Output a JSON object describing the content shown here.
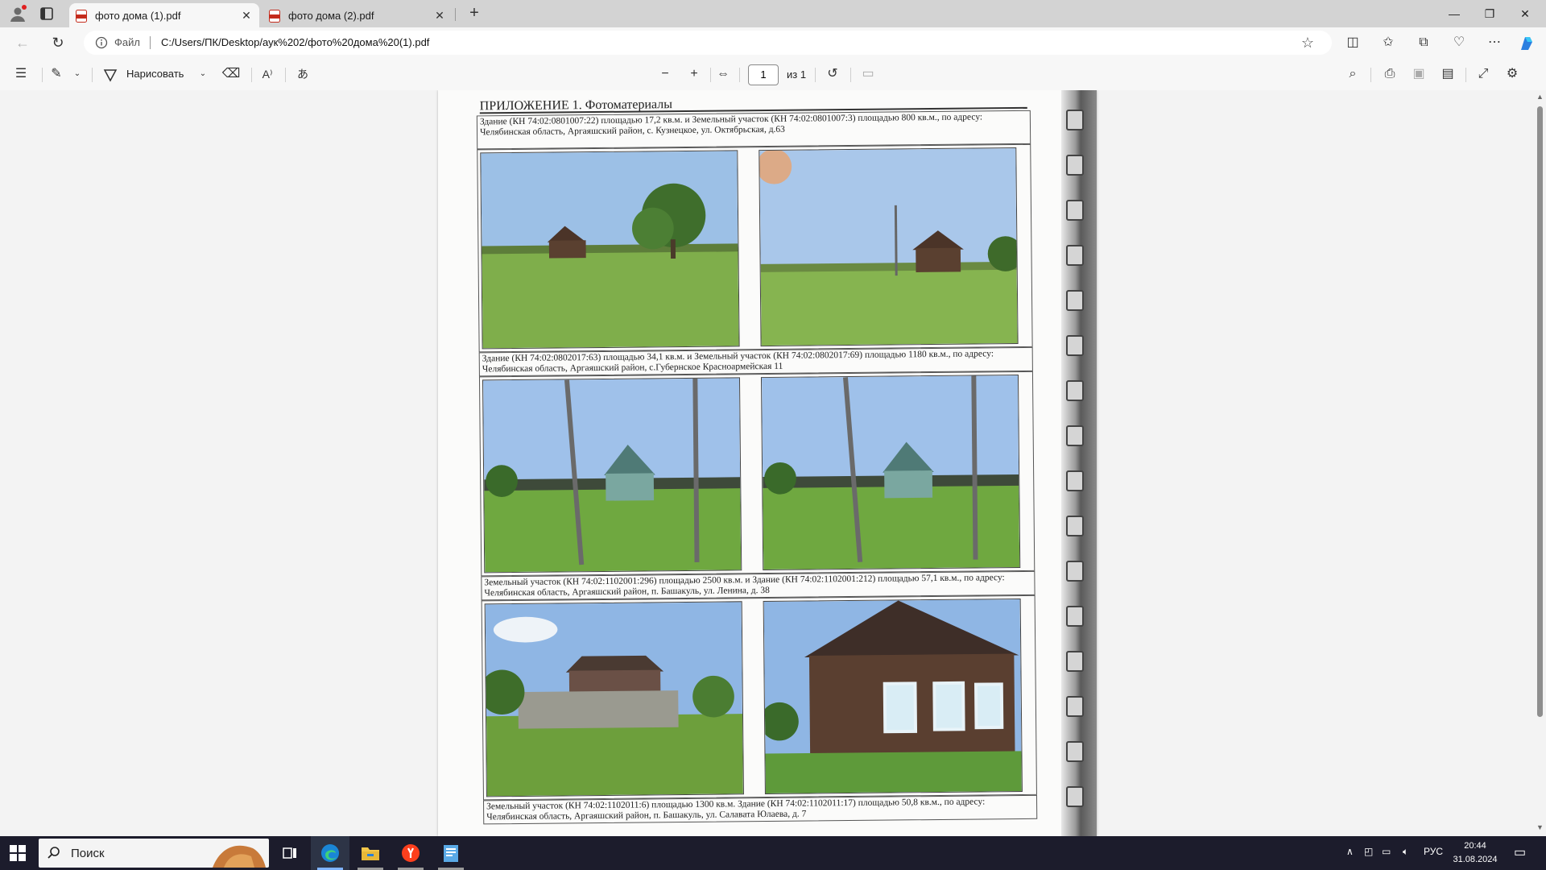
{
  "browser": {
    "tabs": [
      {
        "label": "фото дома (1).pdf",
        "active": true
      },
      {
        "label": "фото дома (2).pdf",
        "active": false
      }
    ],
    "address": {
      "scheme": "Файл",
      "url": "C:/Users/ПК/Desktop/аук%202/фото%20дома%20(1).pdf"
    }
  },
  "pdf_toolbar": {
    "draw_label": "Нарисовать",
    "page_current": "1",
    "page_total": "из 1"
  },
  "document": {
    "title": "ПРИЛОЖЕНИЕ 1. Фотоматериалы",
    "captions": [
      "Здание (КН 74:02:0801007:22) площадью 17,2 кв.м. и Земельный участок (КН 74:02:0801007:3) площадью 800 кв.м., по адресу: Челябинская область, Аргаяшский район, с. Кузнецкое, ул. Октябрьская, д.63",
      "Здание (КН 74:02:0802017:63) площадью 34,1 кв.м. и Земельный участок (КН 74:02:0802017:69) площадью 1180 кв.м., по адресу: Челябинская область, Аргаяшский район, с.Губернское Красноармейская 11",
      "Земельный участок (КН 74:02:1102001:296) площадью 2500 кв.м. и Здание (КН 74:02:1102001:212) площадью 57,1 кв.м., по адресу: Челябинская область, Аргаяшский район, п. Башакуль, ул. Ленина, д. 38",
      "Земельный участок (КН 74:02:1102011:6) площадью 1300 кв.м. Здание (КН 74:02:1102011:17) площадью 50,8 кв.м., по адресу: Челябинская область, Аргаяшский район, п. Башакуль, ул. Салавата Юлаева, д. 7"
    ]
  },
  "taskbar": {
    "search_placeholder": "Поиск",
    "language": "РУС",
    "time": "20:44",
    "date": "31.08.2024"
  },
  "colors": {
    "sky": "#8fb3de",
    "grass": "#7fae4b",
    "house_wood": "#5a4030",
    "house_blue": "#7aa7a0"
  }
}
